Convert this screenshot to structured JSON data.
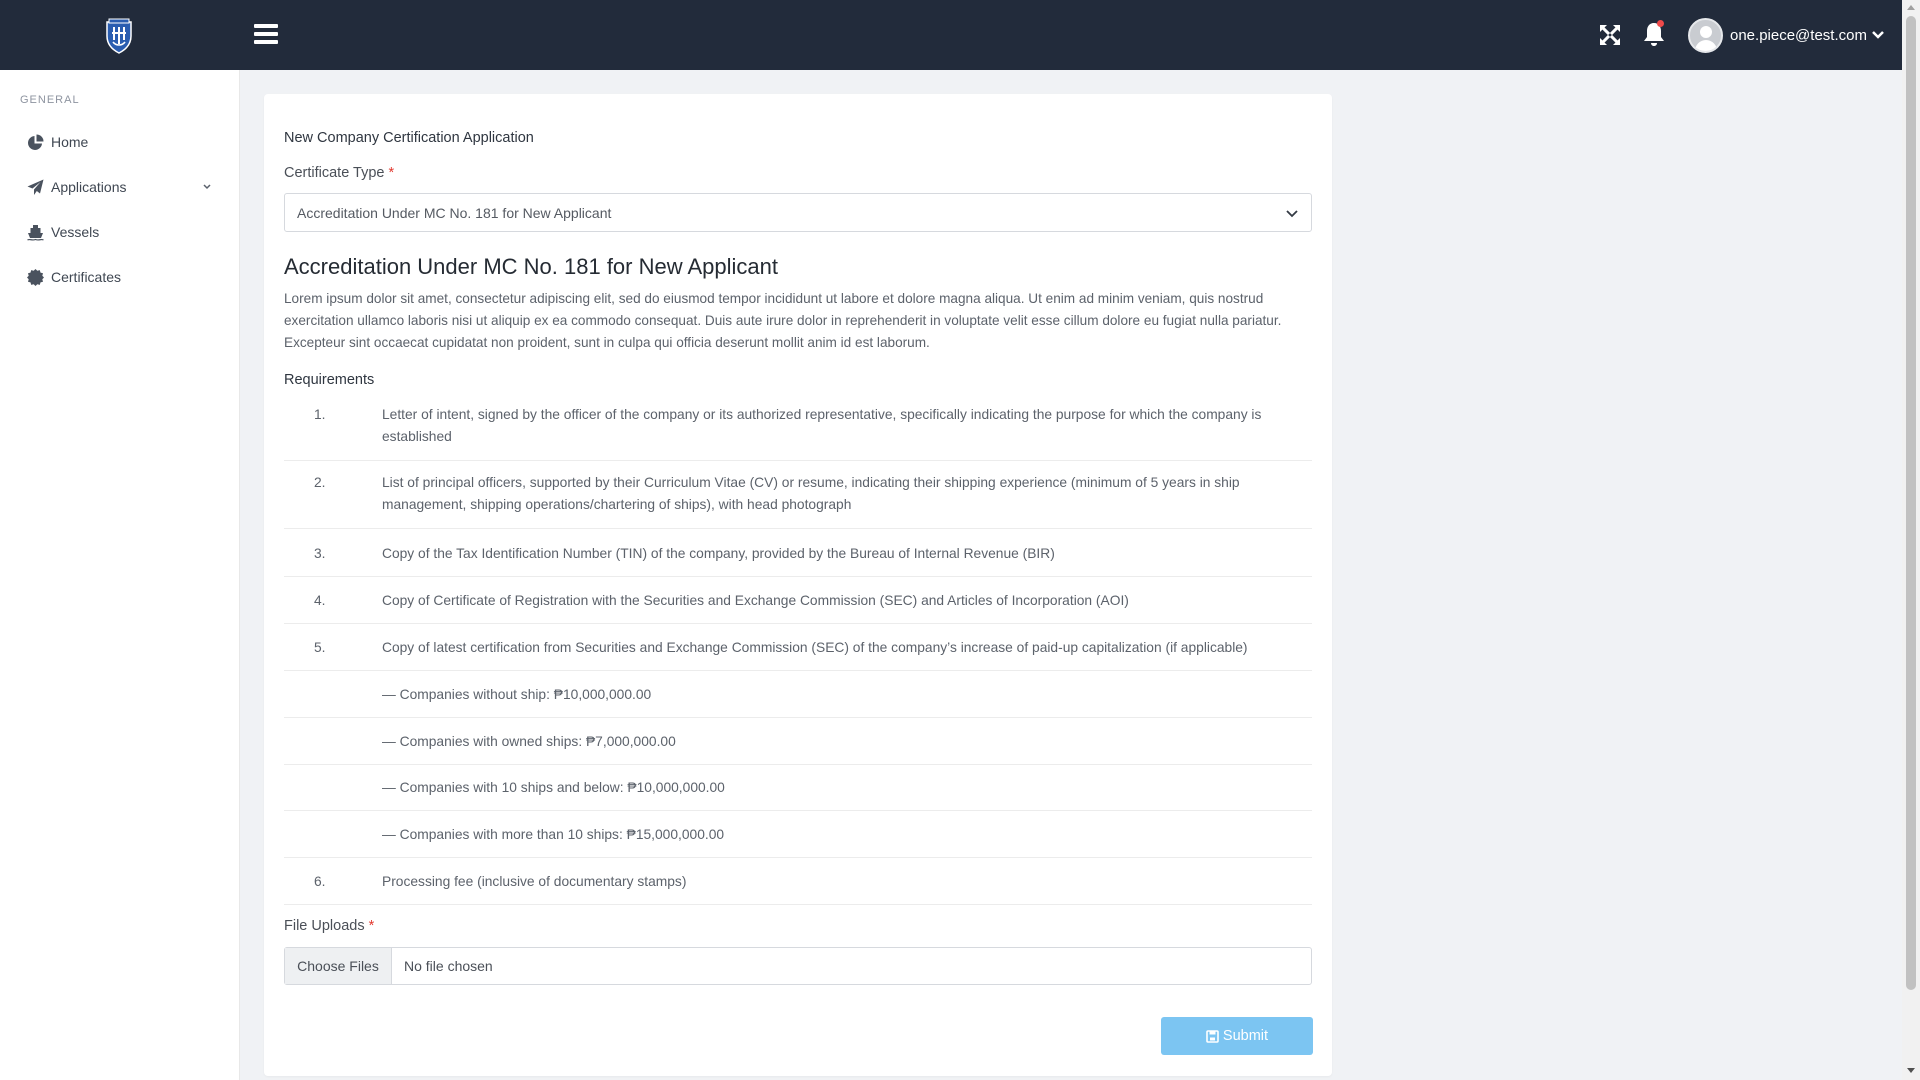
{
  "topbar": {
    "user_email": "one.piece@test.com",
    "icons": [
      "shield-logo-icon",
      "hamburger-icon",
      "expand-icon",
      "bell-icon",
      "user-avatar-icon",
      "chevron-down-icon"
    ],
    "colors": {
      "background": "#222b3b",
      "notification_dot": "#f04a4a"
    }
  },
  "sidebar": {
    "heading": "GENERAL",
    "items": [
      {
        "label": "Home",
        "icon": "pie-chart-icon"
      },
      {
        "label": "Applications",
        "icon": "paper-plane-icon",
        "has_submenu": true
      },
      {
        "label": "Vessels",
        "icon": "ship-icon"
      },
      {
        "label": "Certificates",
        "icon": "certificate-icon"
      }
    ]
  },
  "form": {
    "title": "New Company Certification Application",
    "certificate_type_label": "Certificate Type",
    "required_mark": "*",
    "certificate_type_value": "Accreditation Under MC No. 181 for New Applicant",
    "heading": "Accreditation Under MC No. 181 for New Applicant",
    "description": "Lorem ipsum dolor sit amet, consectetur adipiscing elit, sed do eiusmod tempor incididunt ut labore et dolore magna aliqua. Ut enim ad minim veniam, quis nostrud exercitation ullamco laboris nisi ut aliquip ex ea commodo consequat. Duis aute irure dolor in reprehenderit in voluptate velit esse cillum dolore eu fugiat nulla pariatur. Excepteur sint occaecat cupidatat non proident, sunt in culpa qui officia deserunt mollit anim id est laborum.",
    "requirements_label": "Requirements",
    "requirements": [
      {
        "num": "1.",
        "text": "Letter of intent, signed by the officer of the company or its authorized representative, specifically indicating the purpose for which the company is established"
      },
      {
        "num": "2.",
        "text": "List of principal officers, supported by their Curriculum Vitae (CV) or resume, indicating their shipping experience (minimum of 5 years in ship management, shipping operations/chartering of ships), with head photograph"
      },
      {
        "num": "3.",
        "text": "Copy of the Tax Identification Number (TIN) of the company, provided by the Bureau of Internal Revenue (BIR)"
      },
      {
        "num": "4.",
        "text": "Copy of Certificate of Registration with the Securities and Exchange Commission (SEC) and Articles of Incorporation (AOI)"
      },
      {
        "num": "5.",
        "text": "Copy of latest certification from Securities and Exchange Commission (SEC) of the company’s increase of paid-up capitalization (if applicable)"
      },
      {
        "num": "",
        "text": "— Companies without ship: ₱10,000,000.00"
      },
      {
        "num": "",
        "text": "— Companies with owned ships: ₱7,000,000.00"
      },
      {
        "num": "",
        "text": "— Companies with 10 ships and below: ₱10,000,000.00"
      },
      {
        "num": "",
        "text": "— Companies with more than 10 ships: ₱15,000,000.00"
      },
      {
        "num": "6.",
        "text": "Processing fee (inclusive of documentary stamps)"
      }
    ],
    "file_uploads_label": "File Uploads",
    "choose_files_label": "Choose Files",
    "file_status": "No file chosen",
    "submit_label": "Submit",
    "submit_color": "#7cc5f2"
  }
}
